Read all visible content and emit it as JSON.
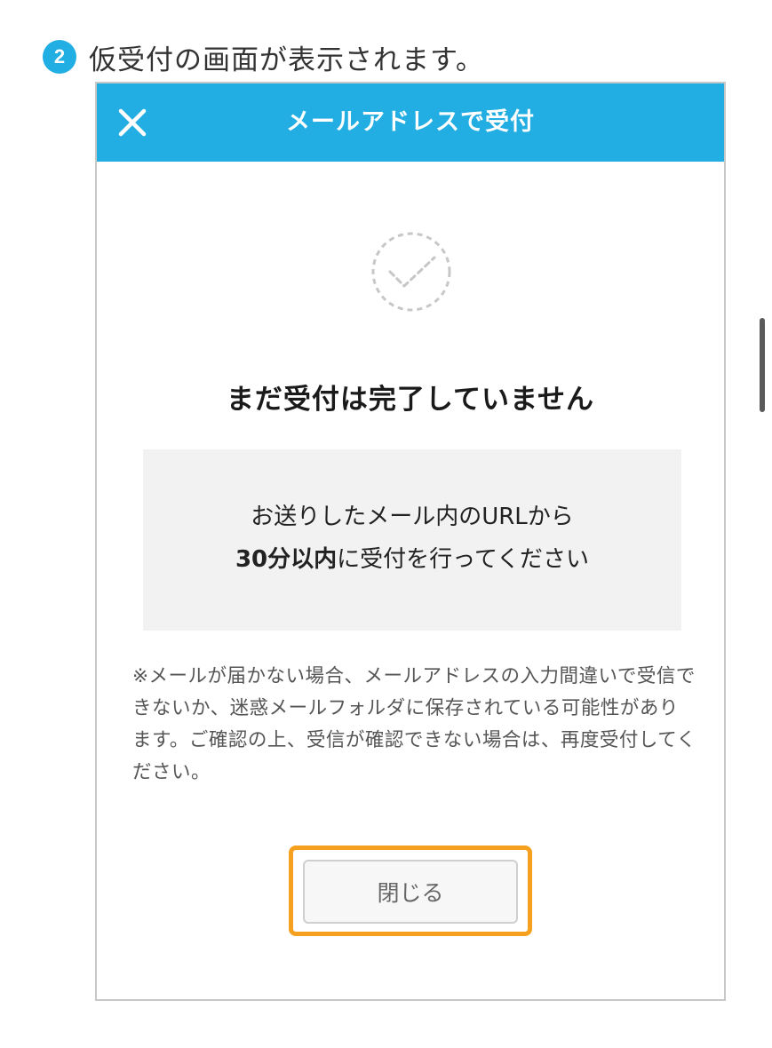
{
  "step": {
    "number": "2",
    "text": "仮受付の画面が表示されます。"
  },
  "header": {
    "title": "メールアドレスで受付",
    "close_icon": "close-icon"
  },
  "status": {
    "icon": "check-circle-icon",
    "title": "まだ受付は完了していません"
  },
  "notice": {
    "line1": "お送りしたメール内のURLから",
    "line2_bold": "30分以内",
    "line2_rest": "に受付を行ってください"
  },
  "note": {
    "text": "※メールが届かない場合、メールアドレスの入力間違いで受信できないか、迷惑メールフォルダに保存されている可能性があります。ご確認の上、受信が確認できない場合は、再度受付してください。"
  },
  "buttons": {
    "close_label": "閉じる"
  },
  "colors": {
    "header": "#22aee3",
    "step_badge": "#20aee3",
    "highlight": "#f5a01f",
    "notice_bg": "#f2f2f2"
  }
}
